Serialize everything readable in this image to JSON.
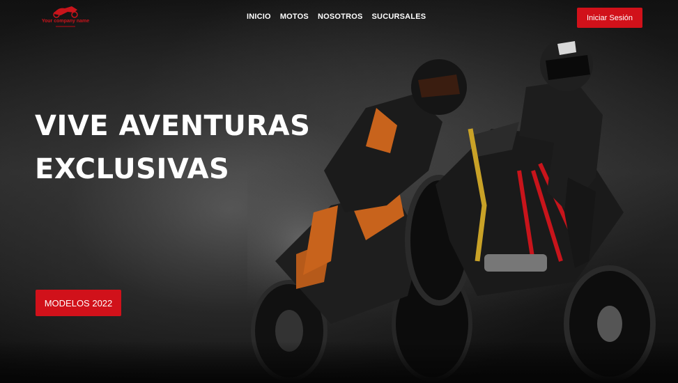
{
  "brand": {
    "logo_text": "Your company name",
    "accent_color": "#d1111a"
  },
  "nav": {
    "items": [
      {
        "label": "INICIO"
      },
      {
        "label": "MOTOS"
      },
      {
        "label": "NOSOTROS"
      },
      {
        "label": "SUCURSALES"
      }
    ]
  },
  "header": {
    "login_label": "Iniciar Sesión"
  },
  "hero": {
    "headline_line1": "VIVE AVENTURAS",
    "headline_line2": "EXCLUSIVAS",
    "cta_label": "MODELOS 2022",
    "image_subject": "two-riders-motorcycles-photo"
  }
}
